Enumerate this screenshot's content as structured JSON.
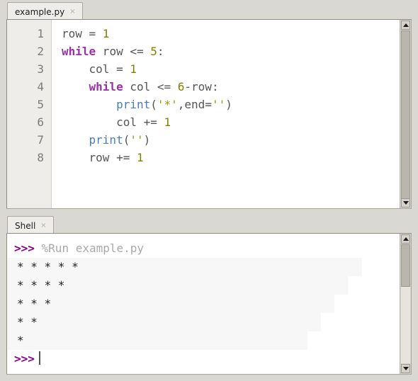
{
  "editor": {
    "tab": {
      "label": "example.py",
      "close_icon": "close-icon",
      "close_glyph": "×"
    },
    "gutter_lines": [
      "1",
      "2",
      "3",
      "4",
      "5",
      "6",
      "7",
      "8"
    ],
    "lines": [
      {
        "n": "1",
        "tokens": [
          {
            "t": "plain",
            "s": "row = "
          },
          {
            "t": "num",
            "s": "1"
          }
        ]
      },
      {
        "n": "2",
        "tokens": [
          {
            "t": "kw",
            "s": "while"
          },
          {
            "t": "plain",
            "s": " row <= "
          },
          {
            "t": "num",
            "s": "5"
          },
          {
            "t": "plain",
            "s": ":"
          }
        ]
      },
      {
        "n": "3",
        "tokens": [
          {
            "t": "plain",
            "s": "    col = "
          },
          {
            "t": "num",
            "s": "1"
          }
        ]
      },
      {
        "n": "4",
        "tokens": [
          {
            "t": "plain",
            "s": "    "
          },
          {
            "t": "kw",
            "s": "while"
          },
          {
            "t": "plain",
            "s": " col <= "
          },
          {
            "t": "num",
            "s": "6"
          },
          {
            "t": "plain",
            "s": "-row:"
          }
        ]
      },
      {
        "n": "5",
        "tokens": [
          {
            "t": "plain",
            "s": "        "
          },
          {
            "t": "fn",
            "s": "print"
          },
          {
            "t": "plain",
            "s": "("
          },
          {
            "t": "str",
            "s": "'*'"
          },
          {
            "t": "plain",
            "s": ",end="
          },
          {
            "t": "str",
            "s": "''"
          },
          {
            "t": "plain",
            "s": ")"
          }
        ]
      },
      {
        "n": "6",
        "tokens": [
          {
            "t": "plain",
            "s": "        col += "
          },
          {
            "t": "num",
            "s": "1"
          }
        ]
      },
      {
        "n": "7",
        "tokens": [
          {
            "t": "plain",
            "s": "    "
          },
          {
            "t": "fn",
            "s": "print"
          },
          {
            "t": "plain",
            "s": "("
          },
          {
            "t": "str",
            "s": "''"
          },
          {
            "t": "plain",
            "s": ")"
          }
        ]
      },
      {
        "n": "8",
        "tokens": [
          {
            "t": "plain",
            "s": "    row += "
          },
          {
            "t": "num",
            "s": "1"
          }
        ]
      }
    ],
    "scrollbar": {
      "up_icon": "scroll-up-arrow-icon",
      "down_icon": "scroll-down-arrow-icon"
    }
  },
  "shell": {
    "tab": {
      "label": "Shell",
      "close_icon": "close-icon",
      "close_glyph": "×"
    },
    "lines": [
      {
        "kind": "command",
        "prompt": ">>>",
        "text": " %Run example.py"
      },
      {
        "kind": "output",
        "text": "* * * * *"
      },
      {
        "kind": "output",
        "text": "* * * *"
      },
      {
        "kind": "output",
        "text": "* * *"
      },
      {
        "kind": "output",
        "text": "* *"
      },
      {
        "kind": "output",
        "text": "*"
      },
      {
        "kind": "prompt",
        "prompt": ">>>",
        "text": ""
      }
    ],
    "scrollbar": {
      "up_icon": "scroll-up-arrow-icon",
      "down_icon": "scroll-down-arrow-icon"
    }
  },
  "colors": {
    "keyword": "#9b31a6",
    "number": "#808000",
    "string": "#9a9a00",
    "function": "#4a7cb5",
    "plain": "#555555",
    "prompt": "#8b008b",
    "command": "#a9a9a9",
    "chrome": "#d9d8d2",
    "tab_active": "#eeedea",
    "gutter": "#eeedea",
    "editor_bg": "#ffffff"
  }
}
